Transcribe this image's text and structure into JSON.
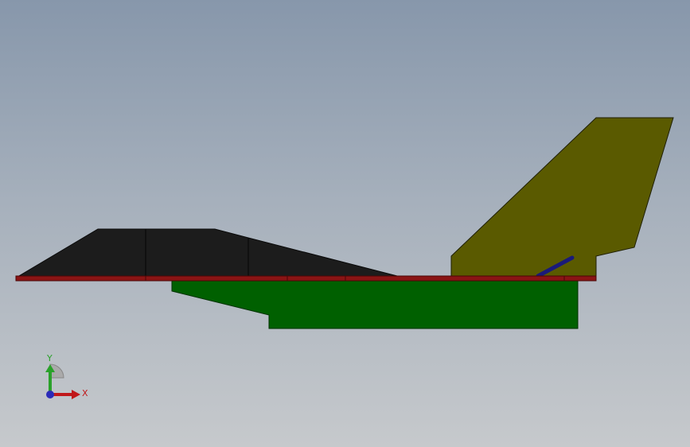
{
  "viewport": {
    "background_top": "#8797ab",
    "background_bottom": "#c6c9cc"
  },
  "model": {
    "parts": [
      {
        "name": "canopy",
        "color": "#1c1c1c"
      },
      {
        "name": "base-plate",
        "color": "#8a1414"
      },
      {
        "name": "fuselage-body",
        "color": "#006000"
      },
      {
        "name": "vertical-tail",
        "color": "#5a5a00"
      },
      {
        "name": "strut",
        "color": "#1a1a7a"
      }
    ]
  },
  "triad": {
    "x_label": "X",
    "y_label": "Y",
    "x_color": "#c0181a",
    "y_color": "#2aa12a",
    "z_color": "#2b2bb8"
  }
}
